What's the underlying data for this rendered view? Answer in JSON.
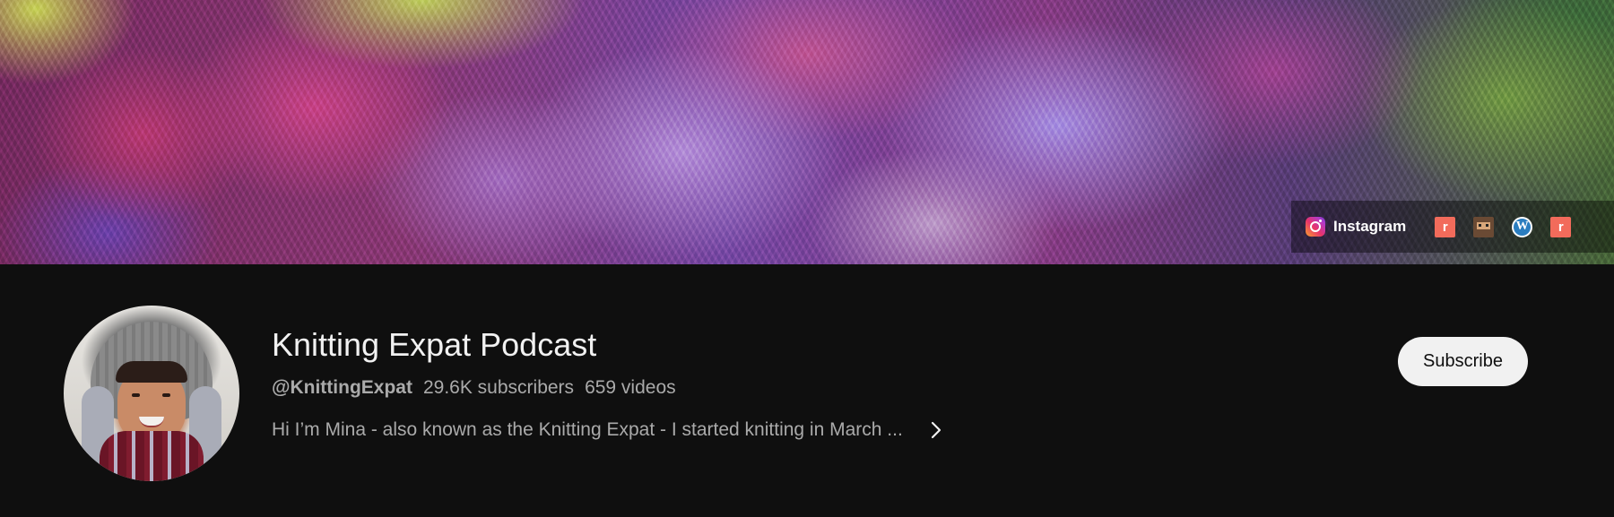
{
  "banner": {
    "links": {
      "instagram_label": "Instagram",
      "instagram_icon": "instagram-icon",
      "icons": [
        "ravelry-icon",
        "profile-image-icon",
        "wordpress-icon",
        "ravelry-icon"
      ],
      "r_glyph": "r",
      "wp_glyph": "W"
    }
  },
  "channel": {
    "title": "Knitting Expat Podcast",
    "handle": "@KnittingExpat",
    "subscribers": "29.6K subscribers",
    "videos": "659 videos",
    "description": "Hi I’m Mina - also known as the Knitting Expat - I started knitting in March ..."
  },
  "actions": {
    "subscribe_label": "Subscribe"
  },
  "colors": {
    "background": "#0f0f0f",
    "button_bg": "#f1f1f1",
    "secondary_text": "#aaaaaa"
  }
}
